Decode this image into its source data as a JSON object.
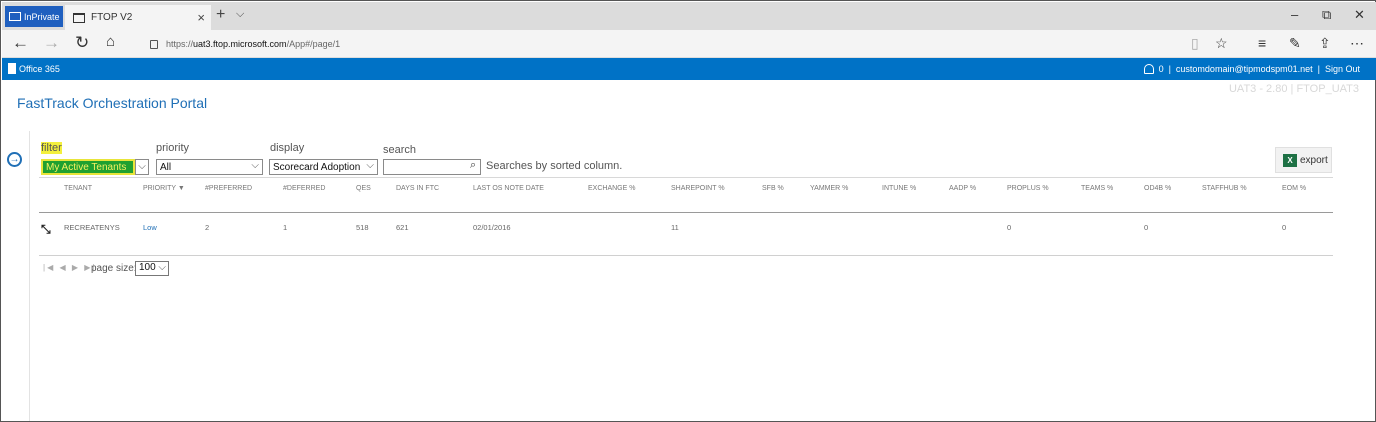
{
  "browser": {
    "inprivate_label": "InPrivate",
    "tab_title": "FTOP V2",
    "tab_close": "×",
    "new_tab": "+",
    "tab_menu": "⌵",
    "url_prefix": "https://",
    "url_host": "uat3.ftop.microsoft.com",
    "url_path": "/App#/page/1",
    "controls": {
      "minimize": "–",
      "restore": "⧉",
      "close": "✕"
    }
  },
  "office_bar": {
    "brand": "Office 365",
    "notification_count": "0",
    "separator": "|",
    "user": "customdomain@tipmodspm01.net",
    "sign_out": "Sign Out"
  },
  "page": {
    "title": "FastTrack Orchestration Portal",
    "version": "UAT3 - 2.80 | FTOP_UAT3"
  },
  "filters": {
    "filter_label": "filter",
    "filter_value": "My Active Tenants",
    "priority_label": "priority",
    "priority_value": "All",
    "display_label": "display",
    "display_value": "Scorecard Adoption",
    "search_label": "search",
    "search_value": "",
    "search_hint": "Searches by sorted column.",
    "export_label": "export"
  },
  "table": {
    "columns": [
      "TENANT",
      "PRIORITY ▼",
      "#PREFERRED",
      "#DEFERRED",
      "QES",
      "DAYS IN FTC",
      "LAST OS NOTE DATE",
      "EXCHANGE %",
      "SHAREPOINT %",
      "SFB %",
      "YAMMER %",
      "INTUNE %",
      "AADP %",
      "PROPLUS %",
      "TEAMS %",
      "OD4B %",
      "STAFFHUB %",
      "EOM %"
    ],
    "rows": [
      {
        "tenant": "RECREATENYS",
        "priority": "Low",
        "preferred": "2",
        "deferred": "1",
        "qes": "518",
        "days": "621",
        "note_date": "02/01/2016",
        "exchange": "",
        "sharepoint": "11",
        "sfb": "",
        "yammer": "",
        "intune": "",
        "aadp": "",
        "proplus": "0",
        "teams": "",
        "od4b": "0",
        "staffhub": "",
        "eom": "0"
      }
    ]
  },
  "pager": {
    "nav": "|◀ ◀ ▶ ▶|",
    "size_label": "page size:",
    "size_value": "100"
  }
}
